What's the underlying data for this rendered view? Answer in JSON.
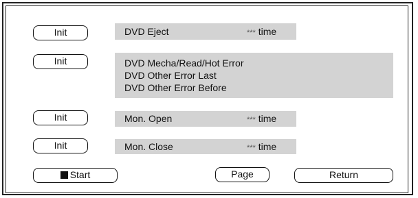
{
  "rows": [
    {
      "button": "Init",
      "label": "DVD Eject",
      "stars": "***",
      "unit": "time"
    },
    {
      "button": "Init",
      "lines": [
        "DVD Mecha/Read/Hot Error",
        "DVD Other Error Last",
        "DVD Other Error Before"
      ]
    },
    {
      "button": "Init",
      "label": "Mon. Open",
      "stars": "***",
      "unit": "time"
    },
    {
      "button": "Init",
      "label": "Mon. Close",
      "stars": "***",
      "unit": "time"
    }
  ],
  "footer": {
    "start_label": "Start",
    "page_label": "Page",
    "return_label": "Return"
  },
  "colors": {
    "panel": "#d3d3d3",
    "border": "#222222"
  }
}
